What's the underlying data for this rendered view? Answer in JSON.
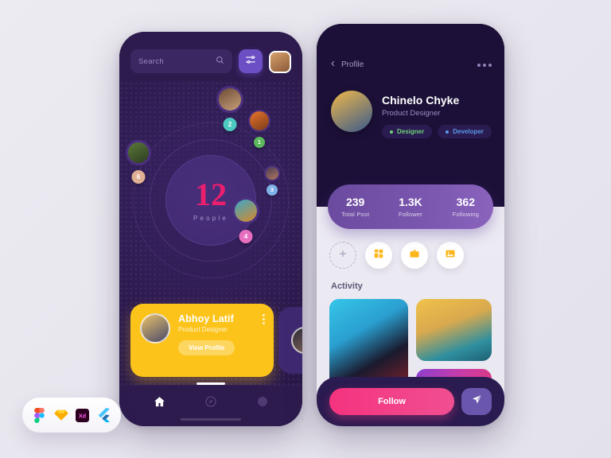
{
  "left_phone": {
    "search": {
      "placeholder": "Search",
      "icon": "search-icon"
    },
    "filter_icon": "sliders-filter-icon",
    "avatar_icon": "user-avatar",
    "radar": {
      "count": "12",
      "count_label": "People",
      "pins": [
        {
          "badge": "2",
          "color": "#4cc9c0",
          "avatar": "av-1"
        },
        {
          "badge": "1",
          "color": "#5cb85c",
          "avatar": "av-2"
        },
        {
          "badge": "6",
          "color": "#e0b094",
          "avatar": "av-3"
        },
        {
          "badge": "3",
          "color": "#7fb3e8",
          "avatar": "av-5"
        },
        {
          "badge": "4",
          "color": "#e86fc0",
          "avatar": "av-4"
        }
      ]
    },
    "card": {
      "name": "Abhoy Latif",
      "role": "Product Designer",
      "button": "View Profile",
      "menu_icon": "more-vertical-icon",
      "accent": "#fcc41b"
    },
    "nav": [
      {
        "name": "home",
        "icon": "home-icon",
        "active": true
      },
      {
        "name": "explore",
        "icon": "compass-icon",
        "active": false
      },
      {
        "name": "profile",
        "icon": "circle-profile-icon",
        "active": false
      }
    ]
  },
  "right_phone": {
    "header": {
      "back_label": "Profile",
      "back_icon": "chevron-left-icon",
      "menu_icon": "more-horizontal-icon"
    },
    "profile": {
      "name": "Chinelo Chyke",
      "role": "Product Designer",
      "tags": [
        {
          "label": "Designer",
          "color": "#6fcf7a"
        },
        {
          "label": "Developer",
          "color": "#5b9ae8"
        }
      ]
    },
    "stats": [
      {
        "value": "239",
        "label": "Total Post"
      },
      {
        "value": "1.3K",
        "label": "Follower"
      },
      {
        "value": "362",
        "label": "Following"
      }
    ],
    "actions": [
      {
        "name": "add",
        "icon": "plus-icon"
      },
      {
        "name": "grid",
        "icon": "grid-icon"
      },
      {
        "name": "work",
        "icon": "briefcase-icon"
      },
      {
        "name": "photos",
        "icon": "image-icon"
      }
    ],
    "activity_title": "Activity",
    "footer": {
      "follow_label": "Follow",
      "send_icon": "paper-plane-icon",
      "follow_color": "#f5337f"
    }
  },
  "tools": [
    {
      "name": "figma",
      "label": "Figma"
    },
    {
      "name": "sketch",
      "label": "Sketch"
    },
    {
      "name": "adobe-xd",
      "label": "Xd"
    },
    {
      "name": "flutter",
      "label": "Flutter"
    }
  ]
}
